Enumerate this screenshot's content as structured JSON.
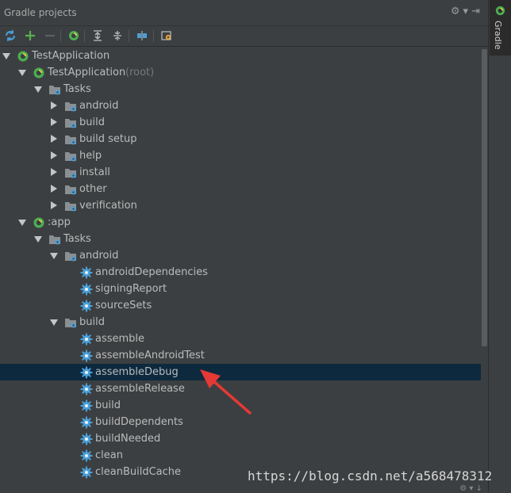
{
  "panel": {
    "title": "Gradle projects"
  },
  "sidebar": {
    "tab_label": "Gradle"
  },
  "tree": [
    {
      "label": "TestApplication",
      "extra": "",
      "level": 0,
      "expand": "down",
      "icon": "gradle-icon"
    },
    {
      "label": "TestApplication",
      "extra": " (root)",
      "level": 1,
      "expand": "down",
      "icon": "gradle-icon"
    },
    {
      "label": "Tasks",
      "extra": "",
      "level": 2,
      "expand": "down",
      "icon": "folder-icon"
    },
    {
      "label": "android",
      "extra": "",
      "level": 3,
      "expand": "right",
      "icon": "folder-icon"
    },
    {
      "label": "build",
      "extra": "",
      "level": 3,
      "expand": "right",
      "icon": "folder-icon"
    },
    {
      "label": "build setup",
      "extra": "",
      "level": 3,
      "expand": "right",
      "icon": "folder-icon"
    },
    {
      "label": "help",
      "extra": "",
      "level": 3,
      "expand": "right",
      "icon": "folder-icon"
    },
    {
      "label": "install",
      "extra": "",
      "level": 3,
      "expand": "right",
      "icon": "folder-icon"
    },
    {
      "label": "other",
      "extra": "",
      "level": 3,
      "expand": "right",
      "icon": "folder-icon"
    },
    {
      "label": "verification",
      "extra": "",
      "level": 3,
      "expand": "right",
      "icon": "folder-icon"
    },
    {
      "label": ":app",
      "extra": "",
      "level": 1,
      "expand": "down",
      "icon": "gradle-icon"
    },
    {
      "label": "Tasks",
      "extra": "",
      "level": 2,
      "expand": "down",
      "icon": "folder-icon"
    },
    {
      "label": "android",
      "extra": "",
      "level": 3,
      "expand": "down",
      "icon": "folder-icon"
    },
    {
      "label": "androidDependencies",
      "extra": "",
      "level": 4,
      "expand": "none",
      "icon": "gear-icon"
    },
    {
      "label": "signingReport",
      "extra": "",
      "level": 4,
      "expand": "none",
      "icon": "gear-icon"
    },
    {
      "label": "sourceSets",
      "extra": "",
      "level": 4,
      "expand": "none",
      "icon": "gear-icon"
    },
    {
      "label": "build",
      "extra": "",
      "level": 3,
      "expand": "down",
      "icon": "folder-icon"
    },
    {
      "label": "assemble",
      "extra": "",
      "level": 4,
      "expand": "none",
      "icon": "gear-icon"
    },
    {
      "label": "assembleAndroidTest",
      "extra": "",
      "level": 4,
      "expand": "none",
      "icon": "gear-icon"
    },
    {
      "label": "assembleDebug",
      "extra": "",
      "level": 4,
      "expand": "none",
      "icon": "gear-icon",
      "selected": true
    },
    {
      "label": "assembleRelease",
      "extra": "",
      "level": 4,
      "expand": "none",
      "icon": "gear-icon"
    },
    {
      "label": "build",
      "extra": "",
      "level": 4,
      "expand": "none",
      "icon": "gear-icon"
    },
    {
      "label": "buildDependents",
      "extra": "",
      "level": 4,
      "expand": "none",
      "icon": "gear-icon"
    },
    {
      "label": "buildNeeded",
      "extra": "",
      "level": 4,
      "expand": "none",
      "icon": "gear-icon"
    },
    {
      "label": "clean",
      "extra": "",
      "level": 4,
      "expand": "none",
      "icon": "gear-icon"
    },
    {
      "label": "cleanBuildCache",
      "extra": "",
      "level": 4,
      "expand": "none",
      "icon": "gear-icon"
    }
  ],
  "watermark": "https://blog.csdn.net/a568478312",
  "colors": {
    "selection": "#0d293e",
    "accent_green": "#4caf50",
    "gear_blue": "#4a9fd8",
    "arrow_red": "#e53935"
  }
}
